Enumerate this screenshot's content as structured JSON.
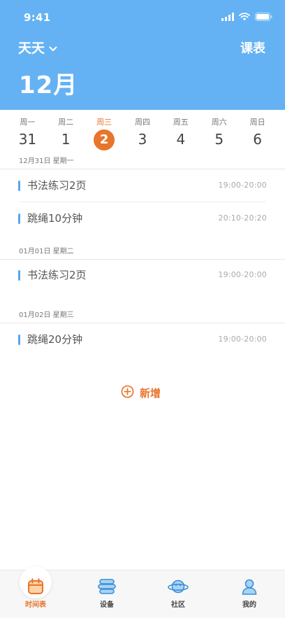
{
  "status_bar": {
    "time": "9:41"
  },
  "header": {
    "user_name": "天天",
    "schedule_link": "课表",
    "month": "12月"
  },
  "week": {
    "days": [
      {
        "name": "周一",
        "date": "31"
      },
      {
        "name": "周二",
        "date": "1"
      },
      {
        "name": "周三",
        "date": "2",
        "selected": true
      },
      {
        "name": "周四",
        "date": "3"
      },
      {
        "name": "周五",
        "date": "4"
      },
      {
        "name": "周六",
        "date": "5"
      },
      {
        "name": "周日",
        "date": "6"
      }
    ]
  },
  "schedule": [
    {
      "date_label": "12月31日 星期一",
      "tasks": [
        {
          "title": "书法练习2页",
          "time": "19:00-20:00"
        },
        {
          "title": "跳绳10分钟",
          "time": "20:10-20:20"
        }
      ]
    },
    {
      "date_label": "01月01日 星期二",
      "tasks": [
        {
          "title": "书法练习2页",
          "time": "19:00-20:00"
        }
      ]
    },
    {
      "date_label": "01月02日 星期三",
      "tasks": [
        {
          "title": "跳绳20分钟",
          "time": "19:00-20:00"
        }
      ]
    }
  ],
  "add_button": {
    "label": "新增",
    "icon": "plus-circle-icon"
  },
  "tabbar": {
    "items": [
      {
        "label": "时间表",
        "icon": "calendar-icon",
        "active": true
      },
      {
        "label": "设备",
        "icon": "device-icon"
      },
      {
        "label": "社区",
        "icon": "planet-icon"
      },
      {
        "label": "我的",
        "icon": "person-icon"
      }
    ]
  },
  "colors": {
    "header_bg": "#64b2f4",
    "accent": "#e8752c",
    "task_marker": "#5aa6ea"
  }
}
